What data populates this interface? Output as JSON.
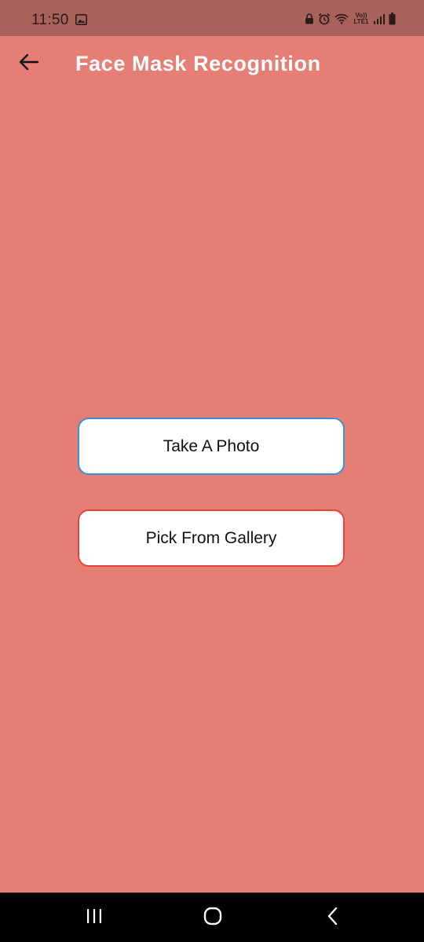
{
  "status_bar": {
    "time": "11:50",
    "icons": [
      "gallery-icon",
      "lock-icon",
      "alarm-icon",
      "wifi-icon",
      "volte-lte-icon",
      "signal-icon",
      "battery-icon"
    ],
    "volte_label": "Vo)) LTE1"
  },
  "app_bar": {
    "title": "Face Mask Recognition",
    "back_icon": "arrow-back-icon"
  },
  "actions": {
    "take_photo_label": "Take A Photo",
    "pick_gallery_label": "Pick From Gallery"
  },
  "nav_bar": {
    "recent_icon": "recent-apps-icon",
    "home_icon": "home-icon",
    "back_icon": "back-chevron-icon"
  },
  "colors": {
    "background": "#e57f76",
    "status_bar": "#a9625b",
    "take_photo_border": "#3d8fd6",
    "pick_gallery_border": "#e4453a"
  }
}
